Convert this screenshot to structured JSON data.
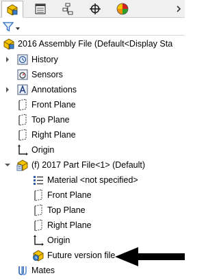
{
  "tabs": [
    {
      "name": "featuremanager-tab",
      "icon": "assembly-tree-icon",
      "active": true
    },
    {
      "name": "propertymanager-tab",
      "icon": "property-list-icon",
      "active": false
    },
    {
      "name": "configurationmanager-tab",
      "icon": "configuration-icon",
      "active": false
    },
    {
      "name": "dimxpert-tab",
      "icon": "crosshair-target-icon",
      "active": false
    },
    {
      "name": "displaymanager-tab",
      "icon": "color-sphere-icon",
      "active": false
    }
  ],
  "tree": {
    "root_label": "2016 Assembly File  (Default<Display Sta",
    "history": "History",
    "sensors": "Sensors",
    "annotations": "Annotations",
    "front_plane": "Front Plane",
    "top_plane": "Top Plane",
    "right_plane": "Right Plane",
    "origin": "Origin",
    "part": {
      "label": "(f) 2017 Part File<1> (Default)",
      "material": "Material <not specified>",
      "front_plane": "Front Plane",
      "top_plane": "Top Plane",
      "right_plane": "Right Plane",
      "origin": "Origin",
      "future_version": "Future version file"
    },
    "mates": "Mates"
  },
  "colors": {
    "accent": "#f2a900",
    "arrow": "#000000"
  }
}
